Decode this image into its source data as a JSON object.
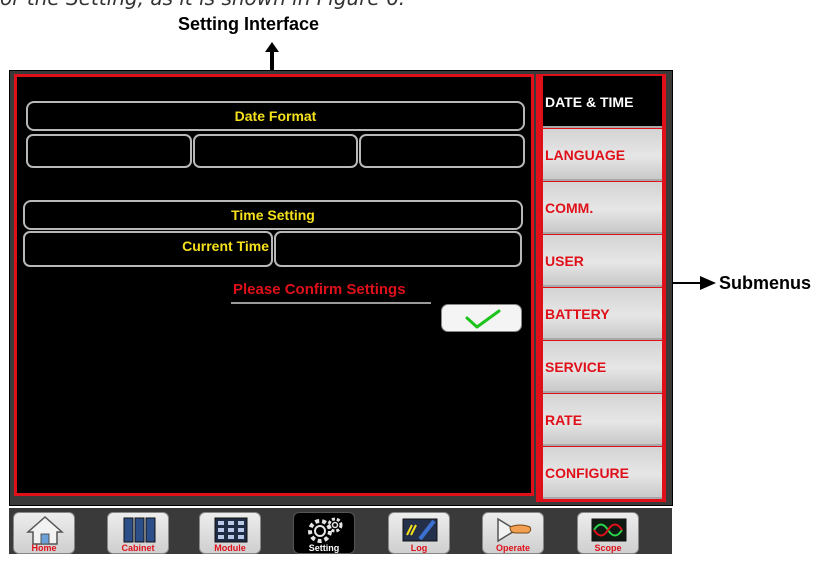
{
  "caption": {
    "partial_text": "or the Setting, as it is shown in Figure 6.",
    "heading": "Setting Interface",
    "submenus_label": "Submenus"
  },
  "main": {
    "date_format_label": "Date Format",
    "time_setting_label": "Time Setting",
    "current_time_label": "Current Time",
    "confirm_text": "Please Confirm Settings"
  },
  "submenus": [
    {
      "label": "DATE & TIME",
      "active": true
    },
    {
      "label": "LANGUAGE"
    },
    {
      "label": "COMM."
    },
    {
      "label": "USER"
    },
    {
      "label": "BATTERY"
    },
    {
      "label": "SERVICE"
    },
    {
      "label": "RATE"
    },
    {
      "label": "CONFIGURE"
    }
  ],
  "toolbar": [
    {
      "label": "Home",
      "icon": "home-icon"
    },
    {
      "label": "Cabinet",
      "icon": "cabinet-icon"
    },
    {
      "label": "Module",
      "icon": "module-icon"
    },
    {
      "label": "Setting",
      "icon": "gear-icon",
      "active": true
    },
    {
      "label": "Log",
      "icon": "log-icon"
    },
    {
      "label": "Operate",
      "icon": "operate-icon"
    },
    {
      "label": "Scope",
      "icon": "scope-icon"
    }
  ],
  "colors": {
    "accent_red": "#e0101a",
    "label_yellow": "#f5e11b",
    "panel_black": "#000000",
    "check_green": "#1cc41c"
  }
}
